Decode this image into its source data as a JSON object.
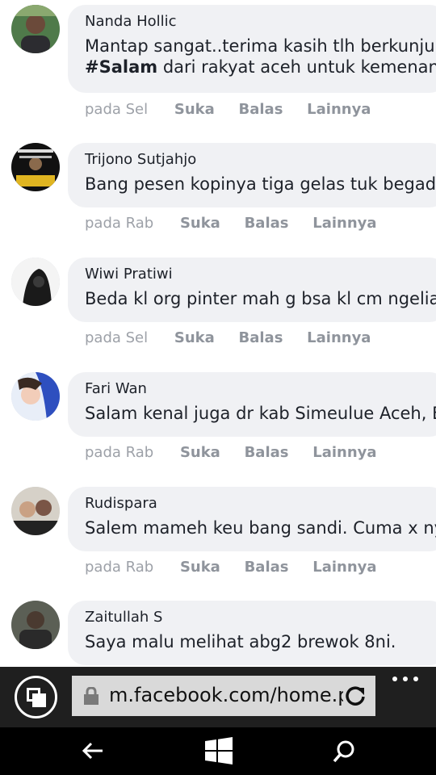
{
  "comments": [
    {
      "author": "Nanda Hollic",
      "text_line1": "Mantap sangat..terima kasih tlh berkunjung ke aceh",
      "text_line2_bold": "#Salam",
      "text_line2_rest": " dari rakyat aceh untuk kemenangan",
      "time": "pada Sel",
      "like": "Suka",
      "reply": "Balas",
      "more": "Lainnya"
    },
    {
      "author": "Trijono Sutjahjo",
      "text": "Bang pesen kopinya tiga gelas tuk begadang",
      "time": "pada Rab",
      "like": "Suka",
      "reply": "Balas",
      "more": "Lainnya"
    },
    {
      "author": "Wiwi Pratiwi",
      "text": "Beda kl org pinter mah g bsa kl cm ngeliat",
      "time": "pada Sel",
      "like": "Suka",
      "reply": "Balas",
      "more": "Lainnya"
    },
    {
      "author": "Fari Wan",
      "text": "Salam kenal juga dr kab Simeulue Aceh, Bang",
      "time": "pada Rab",
      "like": "Suka",
      "reply": "Balas",
      "more": "Lainnya"
    },
    {
      "author": "Rudispara",
      "text": "Salem mameh keu bang sandi. Cuma x nyan",
      "time": "pada Rab",
      "like": "Suka",
      "reply": "Balas",
      "more": "Lainnya"
    },
    {
      "author": "Zaitullah S",
      "text": "Saya malu melihat abg2 brewok 8ni.",
      "time": "",
      "like": "",
      "reply": "",
      "more": ""
    }
  ],
  "browser": {
    "url": "m.facebook.com/home.php",
    "tabs_icon": "tabs-icon",
    "lock_icon": "lock-icon",
    "refresh_icon": "refresh-icon",
    "more_icon": "more-icon"
  },
  "nav": {
    "back_icon": "back-arrow-icon",
    "start_icon": "windows-icon",
    "search_icon": "search-icon"
  },
  "colors": {
    "bubble": "#f0f1f4",
    "author": "#1d2129",
    "meta": "#8f949c",
    "browser_bar": "#1f1f1f",
    "address_bar": "#d9d9d9",
    "nav_bar": "#000000"
  }
}
